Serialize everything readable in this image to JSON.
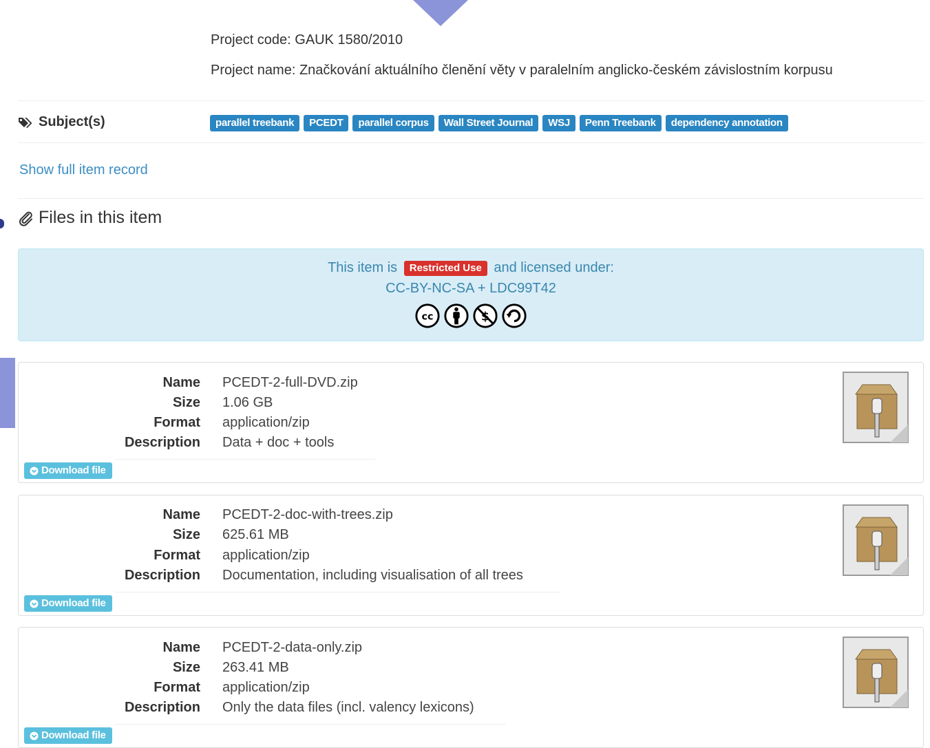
{
  "project": {
    "code_line": "Project code: GAUK 1580/2010",
    "name_line": "Project name: Značkování aktuálního členění věty v paralelním anglicko-českém závislostním korpusu"
  },
  "subjects": {
    "label": "Subject(s)",
    "tags": [
      "parallel treebank",
      "PCEDT",
      "parallel corpus",
      "Wall Street Journal",
      "WSJ",
      "Penn Treebank",
      "dependency annotation"
    ]
  },
  "show_full_record": "Show full item record",
  "files_heading": "Files in this item",
  "license": {
    "prefix": "This item is",
    "badge": "Restricted Use",
    "suffix": "and licensed under:",
    "name": "CC-BY-NC-SA + LDC99T42",
    "icons": [
      "cc-icon",
      "by-icon",
      "nc-icon",
      "sa-icon"
    ]
  },
  "file_labels": {
    "name": "Name",
    "size": "Size",
    "format": "Format",
    "description": "Description",
    "download": "Download file"
  },
  "files": [
    {
      "name": "PCEDT-2-full-DVD.zip",
      "size": "1.06 GB",
      "format": "application/zip",
      "description": "Data + doc + tools"
    },
    {
      "name": "PCEDT-2-doc-with-trees.zip",
      "size": "625.61 MB",
      "format": "application/zip",
      "description": "Documentation, including visualisation of all trees"
    },
    {
      "name": "PCEDT-2-data-only.zip",
      "size": "263.41 MB",
      "format": "application/zip",
      "description": "Only the data files (incl. valency lexicons)"
    }
  ],
  "colors": {
    "tag_bg": "#2a86c2",
    "restricted": "#d9312b",
    "info_bg": "#d9edf7",
    "download_btn": "#5bc0de",
    "accent_nav": "#8b93d9"
  }
}
